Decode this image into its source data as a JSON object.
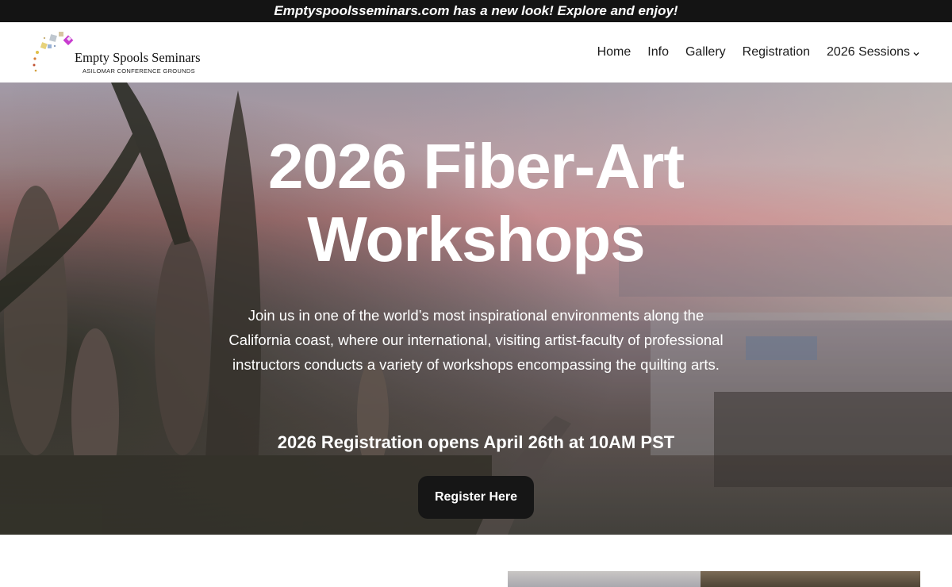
{
  "announcement": "Emptyspoolsseminars.com has a new look! Explore and enjoy!",
  "logo": {
    "title": "Empty Spools Seminars",
    "subtitle": "ASILOMAR CONFERENCE GROUNDS"
  },
  "nav": {
    "items": [
      {
        "label": "Home"
      },
      {
        "label": "Info"
      },
      {
        "label": "Gallery"
      },
      {
        "label": "Registration"
      },
      {
        "label": "2026 Sessions",
        "icon": "chevron-down-icon"
      }
    ]
  },
  "hero": {
    "title_line1": "2026 Fiber-Art",
    "title_line2": "Workshops",
    "description": "Join us in one of the world’s most inspirational environments along the California coast, where our international, visiting artist-faculty of professional instructors conducts a variety of workshops encompassing the quilting arts.",
    "registration_note": "2026 Registration opens April 26th at 10AM PST",
    "button_label": "Register Here"
  },
  "colors": {
    "announcement_bg": "#141414",
    "button_bg": "#161616",
    "text_on_hero": "#ffffff"
  }
}
